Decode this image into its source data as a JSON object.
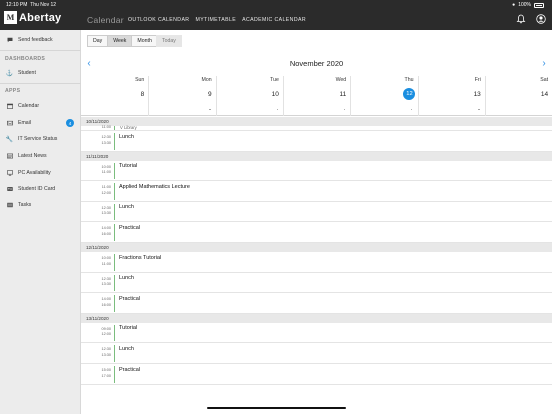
{
  "status": {
    "time": "12:10 PM",
    "date": "Thu Nov 12",
    "battery": "100%"
  },
  "header": {
    "logo_mark": "M",
    "logo_text": "Abertay",
    "title": "Calendar",
    "links": [
      "OUTLOOK CALENDAR",
      "MYTIMETABLE",
      "ACADEMIC CALENDAR"
    ]
  },
  "sidebar": {
    "feedback": "Send feedback",
    "dashboards_label": "DASHBOARDS",
    "student": "Student",
    "apps_label": "APPS",
    "items": [
      {
        "label": "Calendar",
        "icon": "calendar-icon"
      },
      {
        "label": "Email",
        "icon": "email-icon",
        "badge": "4"
      },
      {
        "label": "IT Service Status",
        "icon": "wrench-icon"
      },
      {
        "label": "Latest News",
        "icon": "news-icon"
      },
      {
        "label": "PC Availability",
        "icon": "monitor-icon"
      },
      {
        "label": "Student ID Card",
        "icon": "id-card-icon"
      },
      {
        "label": "Tasks",
        "icon": "tasks-icon"
      }
    ]
  },
  "view_tabs": [
    "Day",
    "Week",
    "Month"
  ],
  "active_tab": "Week",
  "today_label": "Today",
  "month_title": "November 2020",
  "week": [
    {
      "name": "Sun",
      "num": "8",
      "dot": false
    },
    {
      "name": "Mon",
      "num": "9",
      "dot": true
    },
    {
      "name": "Tue",
      "num": "10",
      "dot": true
    },
    {
      "name": "Wed",
      "num": "11",
      "dot": true
    },
    {
      "name": "Thu",
      "num": "12",
      "dot": true,
      "today": true
    },
    {
      "name": "Fri",
      "num": "13",
      "dot": true
    },
    {
      "name": "Sat",
      "num": "14",
      "dot": false
    }
  ],
  "agenda": [
    {
      "date": "10/11/2020",
      "partial_label": "V Library",
      "partial_time": "11:00",
      "events": [
        {
          "start": "12:30",
          "end": "13:30",
          "title": "Lunch"
        }
      ]
    },
    {
      "date": "11/11/2020",
      "events": [
        {
          "start": "10:00",
          "end": "11:00",
          "title": "Tutorial"
        },
        {
          "start": "11:00",
          "end": "12:00",
          "title": "Applied Mathematics Lecture"
        },
        {
          "start": "12:30",
          "end": "13:30",
          "title": "Lunch"
        },
        {
          "start": "14:00",
          "end": "16:00",
          "title": "Practical"
        }
      ]
    },
    {
      "date": "12/11/2020",
      "events": [
        {
          "start": "10:00",
          "end": "11:00",
          "title": "Fractions Tutorial"
        },
        {
          "start": "12:30",
          "end": "13:30",
          "title": "Lunch"
        },
        {
          "start": "14:00",
          "end": "16:00",
          "title": "Practical"
        }
      ]
    },
    {
      "date": "13/11/2020",
      "events": [
        {
          "start": "09:00",
          "end": "12:00",
          "title": "Tutorial"
        },
        {
          "start": "12:30",
          "end": "13:30",
          "title": "Lunch"
        },
        {
          "start": "15:00",
          "end": "17:00",
          "title": "Practical"
        }
      ]
    }
  ],
  "colors": {
    "accent": "#1a8ee0",
    "event_bar": "#7bbd7e",
    "header_bg": "#2b2b2b"
  }
}
